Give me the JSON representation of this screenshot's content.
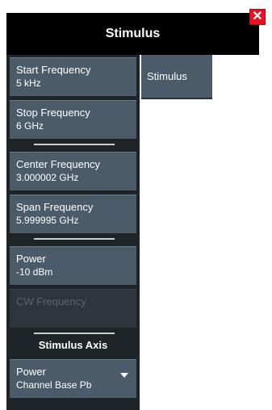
{
  "dialog": {
    "title": "Stimulus"
  },
  "buttons": {
    "start": {
      "label": "Start Frequency",
      "value": "5 kHz"
    },
    "stop": {
      "label": "Stop Frequency",
      "value": "6 GHz"
    },
    "center": {
      "label": "Center Frequency",
      "value": "3.000002 GHz"
    },
    "span": {
      "label": "Span Frequency",
      "value": "5.999995 GHz"
    },
    "power": {
      "label": "Power",
      "value": "-10 dBm"
    },
    "cw": {
      "label": "CW Frequency"
    }
  },
  "axis": {
    "heading": "Stimulus Axis",
    "dropdown": {
      "label": "Power",
      "value": "Channel Base Pb"
    }
  },
  "tabs": [
    {
      "label": "Stimulus"
    }
  ],
  "icons": {
    "close": "close-icon",
    "dropdown": "chevron-down-icon"
  },
  "colors": {
    "titlebar": "#000000",
    "button": "#4c5b69",
    "close": "#e81123",
    "panel": "#1f2429"
  }
}
